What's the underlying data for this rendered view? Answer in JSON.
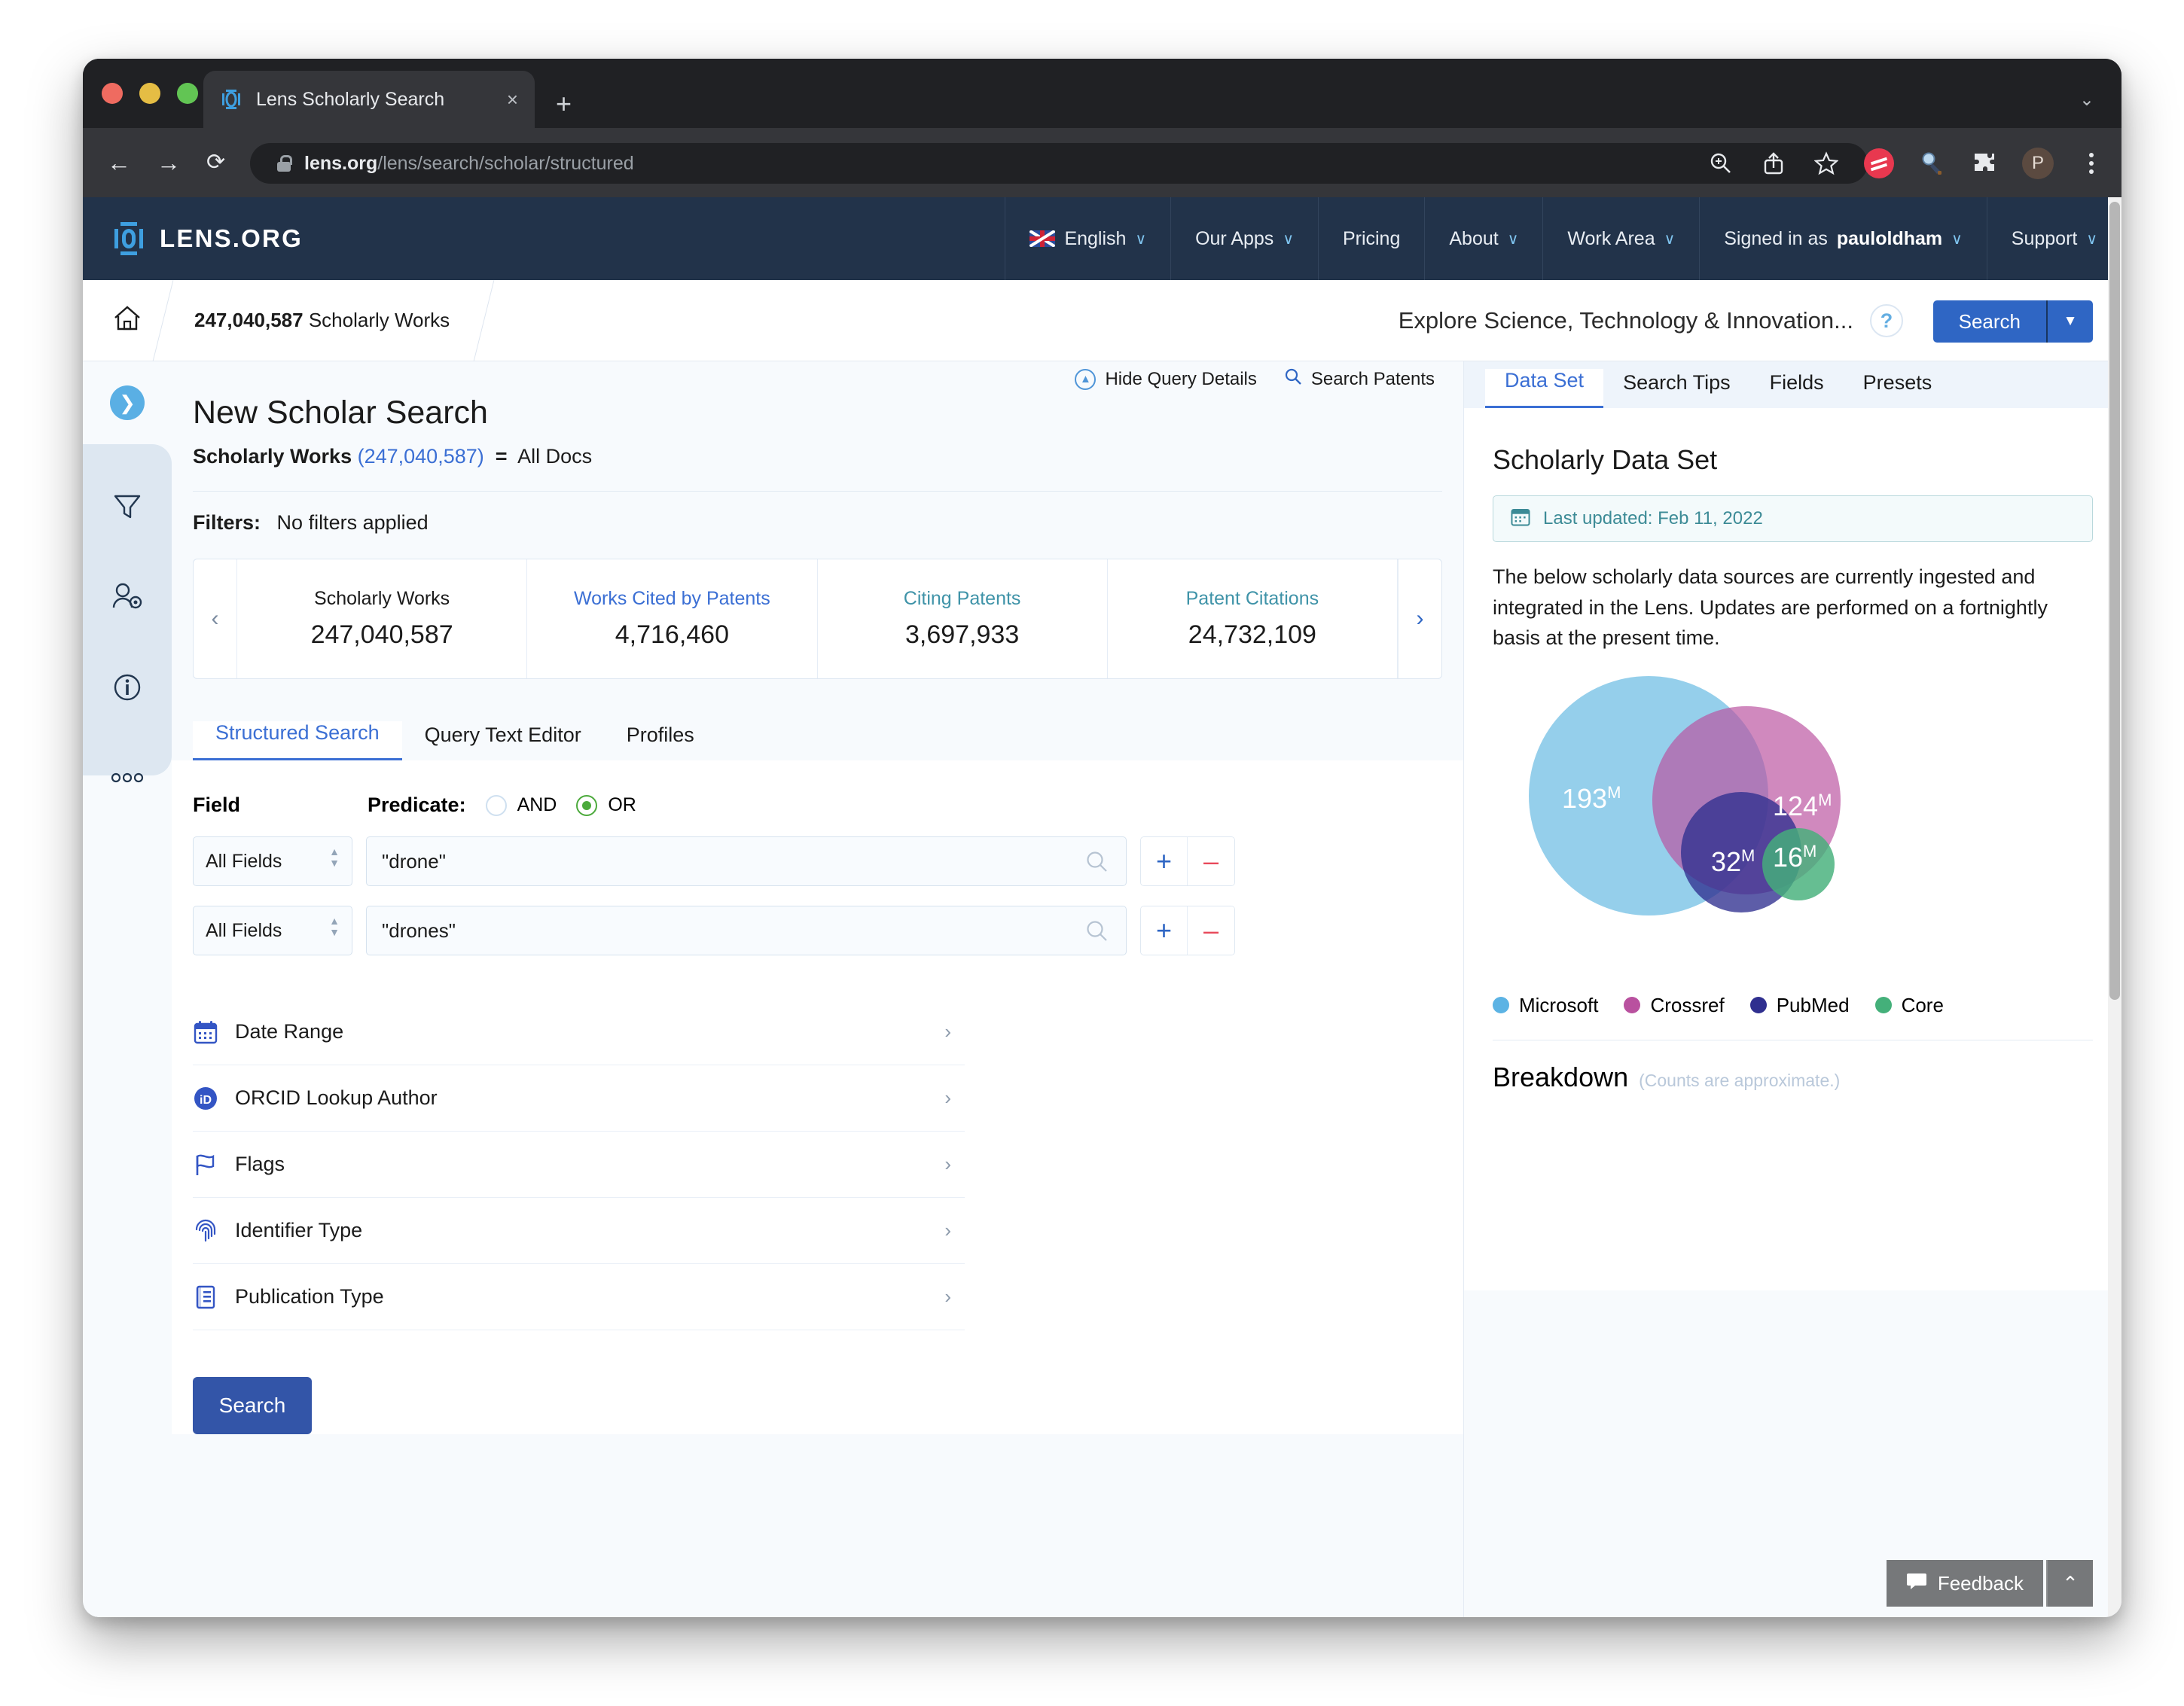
{
  "browser": {
    "tab_title": "Lens Scholarly Search",
    "tab_close": "×",
    "new_tab": "+",
    "window_chevron": "⌄",
    "back": "←",
    "forward": "→",
    "reload": "⟳",
    "url_domain": "lens.org",
    "url_path": "/lens/search/scholar/structured",
    "toolbar_icons": [
      "zoom-search-icon",
      "share-icon",
      "bookmark-star-icon",
      "extension-red-icon",
      "magnifier-extension-icon",
      "puzzle-extension-icon",
      "profile-avatar",
      "kebab-menu-icon"
    ],
    "profile_initial": "P"
  },
  "sitenav": {
    "brand": "LENS.ORG",
    "items": [
      {
        "label": "English",
        "chevron": "∨",
        "flag": true
      },
      {
        "label": "Our Apps",
        "chevron": "∨"
      },
      {
        "label": "Pricing",
        "chevron": ""
      },
      {
        "label": "About",
        "chevron": "∨"
      },
      {
        "label": "Work Area",
        "chevron": "∨"
      },
      {
        "label": "Signed in as",
        "bold": "pauloldham",
        "chevron": "∨"
      },
      {
        "label": "Support",
        "chevron": "∨"
      }
    ]
  },
  "crumbbar": {
    "home_icon": "home-icon",
    "crumb_count": "247,040,587",
    "crumb_label": "Scholarly Works",
    "explore_text": "Explore Science, Technology & Innovation...",
    "help": "?",
    "search_label": "Search",
    "search_split": "▼"
  },
  "query_details": {
    "hide": "Hide Query Details",
    "search_patents": "Search Patents"
  },
  "rail": {
    "toggle": "❯",
    "icons": [
      "filter-funnel-icon",
      "user-settings-icon",
      "info-circle-icon",
      "more-dots-icon"
    ]
  },
  "main": {
    "title": "New Scholar Search",
    "query_prefix": "Scholarly Works",
    "query_count": "(247,040,587)",
    "query_eq": "=",
    "query_value": "All Docs",
    "filters_label": "Filters:",
    "filters_value": "No filters applied",
    "stats": [
      {
        "label": "Scholarly Works",
        "value": "247,040,587",
        "color": "#1b1b1b"
      },
      {
        "label": "Works Cited by Patents",
        "value": "4,716,460",
        "color": "#3b6fd4"
      },
      {
        "label": "Citing Patents",
        "value": "3,697,933",
        "color": "#3f93a8"
      },
      {
        "label": "Patent Citations",
        "value": "24,732,109",
        "color": "#3f93a8"
      }
    ],
    "stat_prev": "‹",
    "stat_next": "›",
    "tabs": [
      {
        "label": "Structured Search",
        "active": true
      },
      {
        "label": "Query Text Editor",
        "active": false
      },
      {
        "label": "Profiles",
        "active": false
      }
    ],
    "field_label": "Field",
    "predicate_label": "Predicate:",
    "predicate_options": [
      {
        "label": "AND",
        "selected": false
      },
      {
        "label": "OR",
        "selected": true
      }
    ],
    "rows": [
      {
        "field": "All Fields",
        "value": "\"drone\"",
        "placeholder": ""
      },
      {
        "field": "All Fields",
        "value": "\"drones\"",
        "placeholder": ""
      }
    ],
    "row_add": "+",
    "row_remove": "‒",
    "accordions": [
      {
        "label": "Date Range",
        "icon": "calendar-icon"
      },
      {
        "label": "ORCID Lookup Author",
        "icon": "orcid-icon"
      },
      {
        "label": "Flags",
        "icon": "flag-icon"
      },
      {
        "label": "Identifier Type",
        "icon": "fingerprint-icon"
      },
      {
        "label": "Publication Type",
        "icon": "document-icon"
      }
    ],
    "accordion_chevron": "›",
    "submit_label": "Search"
  },
  "right": {
    "tabs": [
      {
        "label": "Data Set",
        "active": true
      },
      {
        "label": "Search Tips",
        "active": false
      },
      {
        "label": "Fields",
        "active": false
      },
      {
        "label": "Presets",
        "active": false
      }
    ],
    "heading": "Scholarly Data Set",
    "updated": "Last updated: Feb 11, 2022",
    "updated_icon": "calendar-icon",
    "description": "The below scholarly data sources are currently ingested and integrated in the Lens. Updates are performed on a fortnightly basis at the present time.",
    "breakdown": "Breakdown",
    "breakdown_sub": "(Counts are approximate.)",
    "feedback": "Feedback",
    "feedback_icon": "speech-bubble-icon",
    "collapse": "⌃"
  },
  "chart_data": {
    "type": "venn",
    "title": "Scholarly Data Set",
    "unit": "M",
    "sets": [
      {
        "name": "Microsoft",
        "label": "193",
        "suffix": "M",
        "color": "#84c7e8",
        "value": 193
      },
      {
        "name": "Crossref",
        "label": "124",
        "suffix": "M",
        "color": "#b9519f",
        "value": 124
      },
      {
        "name": "PubMed",
        "label": "32",
        "suffix": "M",
        "color": "#2f2f8f",
        "value": 32
      },
      {
        "name": "Core",
        "label": "16",
        "suffix": "M",
        "color": "#44b07a",
        "value": 16
      }
    ],
    "legend_position": "bottom",
    "note": "Counts are approximate."
  }
}
